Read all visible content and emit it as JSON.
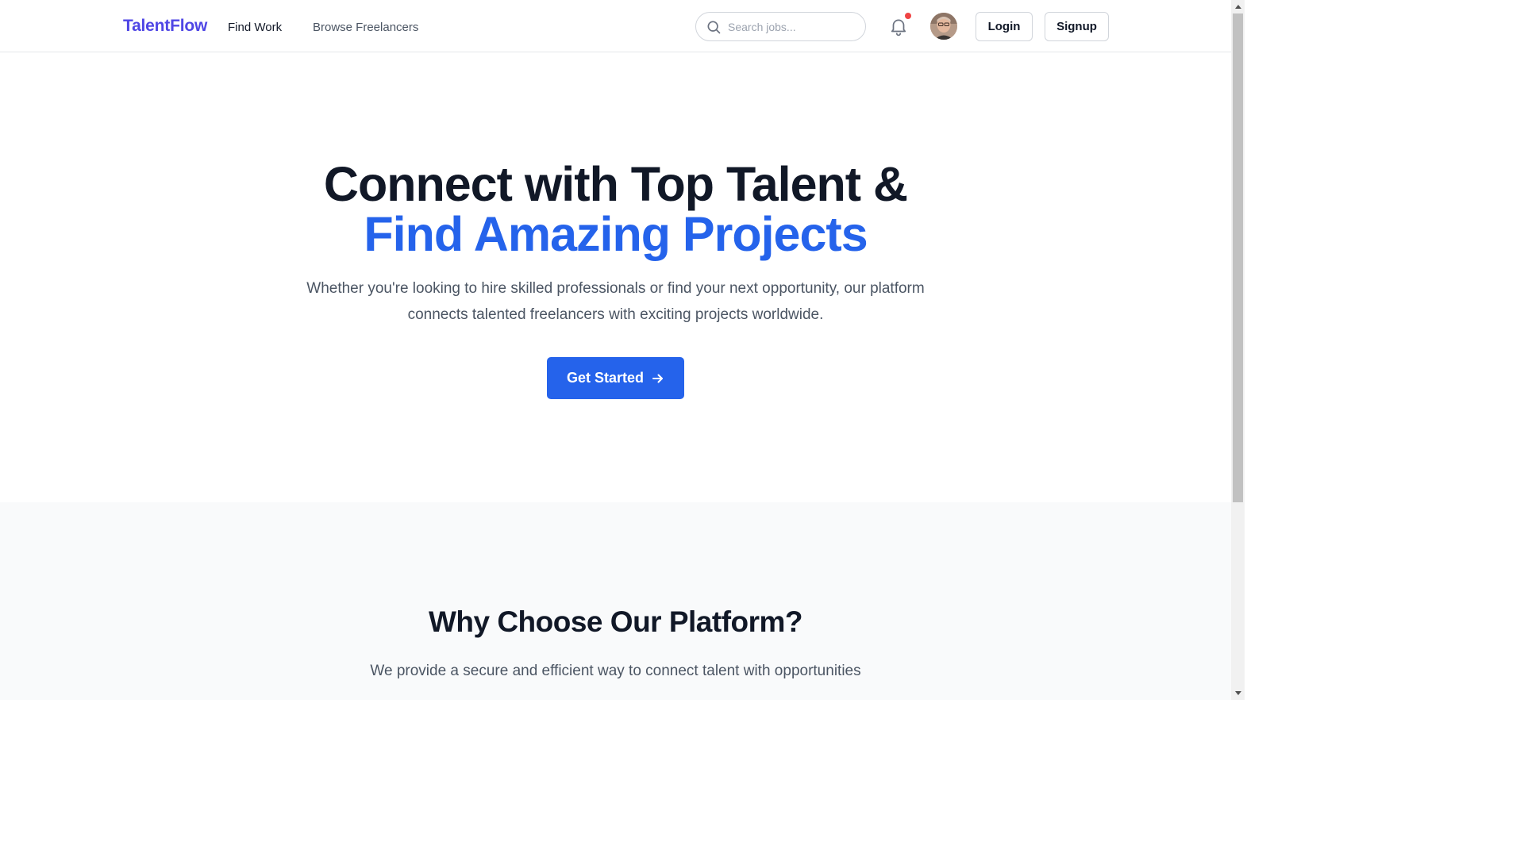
{
  "header": {
    "logo": "TalentFlow",
    "nav": {
      "find_work": "Find Work",
      "browse_freelancers": "Browse Freelancers"
    },
    "search": {
      "placeholder": "Search jobs...",
      "value": ""
    },
    "notifications": {
      "icon": "bell-icon",
      "has_unread": true
    },
    "avatar": {
      "icon": "user-avatar"
    },
    "login_label": "Login",
    "signup_label": "Signup"
  },
  "hero": {
    "title_line1": "Connect with Top Talent &",
    "title_line2": "Find Amazing Projects",
    "subtitle": "Whether you're looking to hire skilled professionals or find your next opportunity, our platform connects talented freelancers with exciting projects worldwide.",
    "cta_label": "Get Started",
    "cta_icon": "arrow-right-icon"
  },
  "features": {
    "title": "Why Choose Our Platform?",
    "subtitle": "We provide a secure and efficient way to connect talent with opportunities"
  },
  "colors": {
    "brand": "#4f46e5",
    "accent": "#2563eb",
    "text": "#111827",
    "muted": "#4b5563",
    "notification_dot": "#ef4444"
  }
}
